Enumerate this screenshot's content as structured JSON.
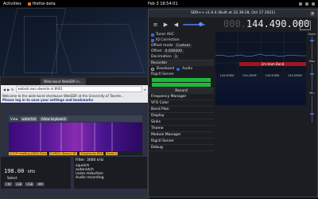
{
  "topbar": {
    "activities": "Activities",
    "app_name": "firefox-beta",
    "clock": "Feb 3 18:54:01"
  },
  "browser": {
    "tab_title": "Wide-band WebSDR in...",
    "url": "websdr.ewi.utwente.nl:8901",
    "notice_a": "Welcome to the wide-band shortwave WebSDR at the University of Twente...",
    "notice_b": "Please log in to save your settings and bookmarks",
    "controls": {
      "view_label": "View",
      "view_value": "waterfall",
      "mode_label": "Allow keyboard"
    },
    "markers": [
      "D-TCP meeting (NDS) Blvd",
      "5-KRGC (Nosoc) Bli",
      "Zoophanes BBB",
      "Radio X"
    ],
    "rx": {
      "freq_value": "198.00",
      "unit": "kHz",
      "select_label": "Select",
      "modes": [
        "CW",
        "LSB",
        "USB",
        "AM"
      ]
    },
    "filter": {
      "title": "Filter: 3680 kHz",
      "opt1": "squelch",
      "opt2": "autonotch",
      "opt3": "noise reduction",
      "opt4": "Audio recording"
    }
  },
  "sdr": {
    "title": "SDR++ v1.0.4 (Built at 22:39:28, Oct 17 2021)",
    "frequency_dim": "000.",
    "frequency": "144.490.000",
    "options": {
      "tuner_agc": "Tuner AGC",
      "iq_correction": "IQ Correction",
      "offset_mode_label": "Offset mode",
      "offset_mode_value": "Custom",
      "offset_label": "Offset",
      "offset_value": "0.000000",
      "decimation_label": "Decimation",
      "decimation_value": "1"
    },
    "sections": {
      "recorder": "Recorder",
      "rigctl": "Rigctl Server",
      "record": "Record"
    },
    "recorder_modes": {
      "baseband": "Baseband",
      "audio": "Audio"
    },
    "module_items": [
      "Frequency Manager",
      "VFO Color",
      "Band Plan",
      "Display",
      "Sinks",
      "Theme",
      "Module Manager",
      "Rigctl Server",
      "Debug"
    ],
    "band_label": "2m Ham Band",
    "axis_ticks": [
      "144.400M",
      "144.450M",
      "144.500M",
      "144.550M"
    ],
    "right": {
      "zoom_label": "Zoom",
      "max_label": "Max",
      "min_label": "Min"
    }
  }
}
